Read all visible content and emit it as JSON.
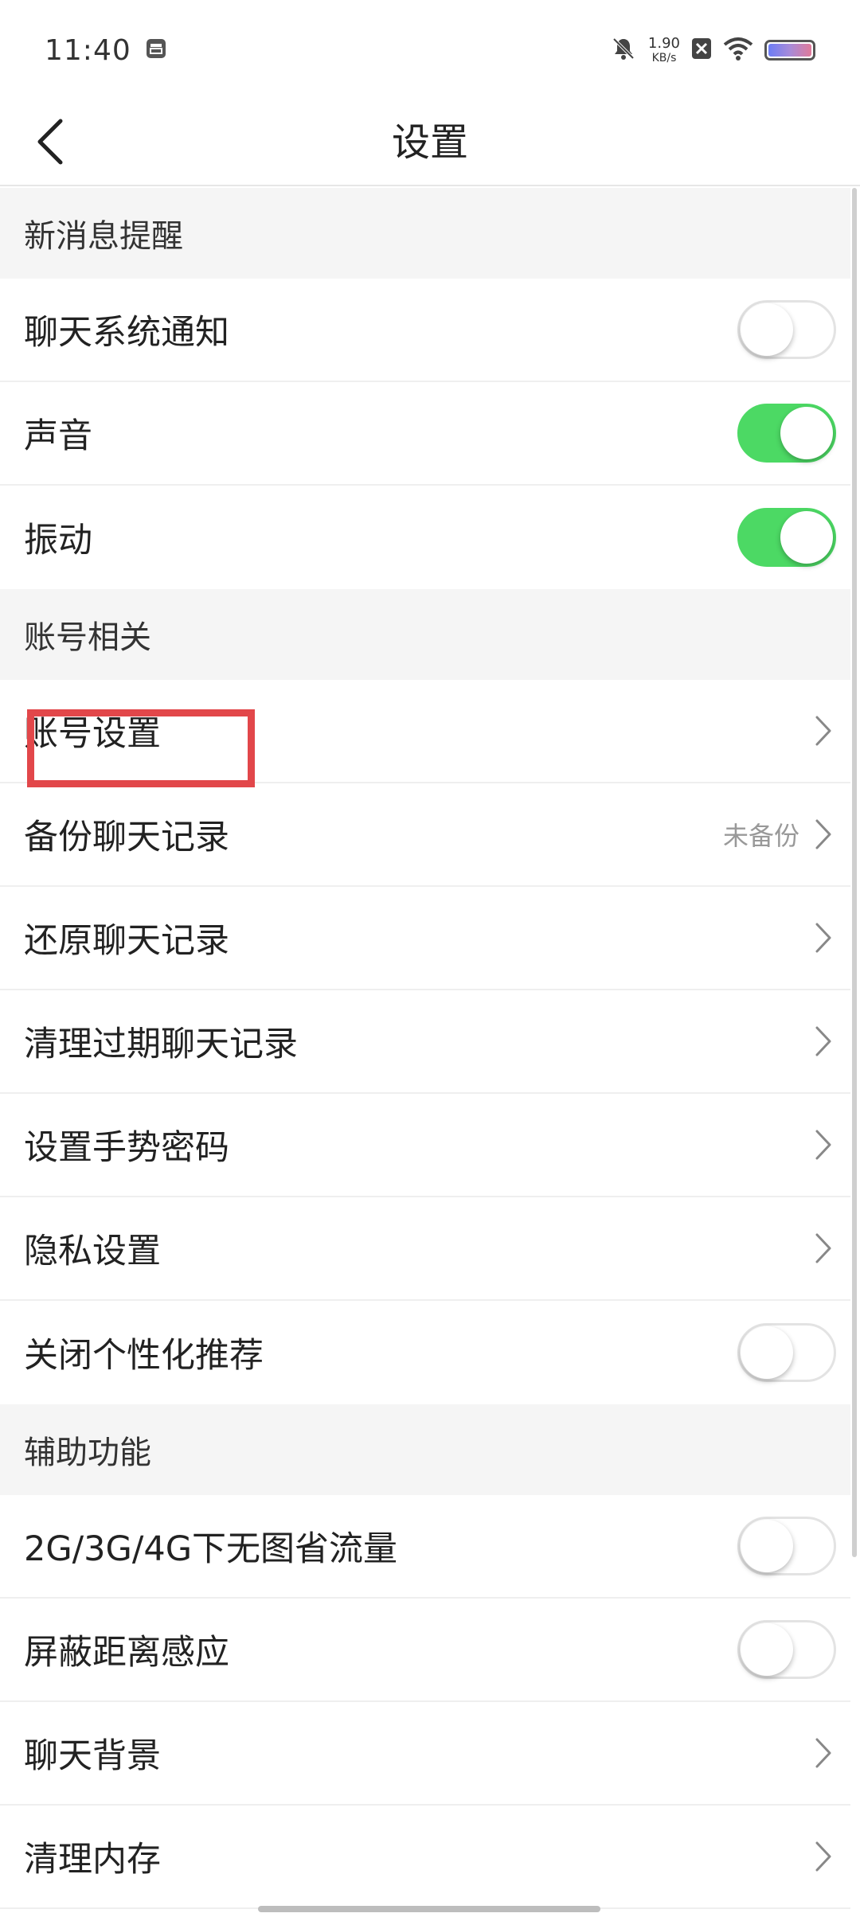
{
  "status_bar": {
    "time": "11:40",
    "net_speed_value": "1.90",
    "net_speed_unit": "KB/s"
  },
  "nav": {
    "title": "设置"
  },
  "sections": {
    "notifications": {
      "header": "新消息提醒",
      "chat_system_notice": {
        "label": "聊天系统通知",
        "enabled": false
      },
      "sound": {
        "label": "声音",
        "enabled": true
      },
      "vibration": {
        "label": "振动",
        "enabled": true
      }
    },
    "account": {
      "header": "账号相关",
      "account_settings": {
        "label": "账号设置"
      },
      "backup_chats": {
        "label": "备份聊天记录",
        "hint": "未备份"
      },
      "restore_chats": {
        "label": "还原聊天记录"
      },
      "clean_expired": {
        "label": "清理过期聊天记录"
      },
      "gesture_password": {
        "label": "设置手势密码"
      },
      "privacy": {
        "label": "隐私设置"
      },
      "disable_recommend": {
        "label": "关闭个性化推荐",
        "enabled": false
      }
    },
    "assist": {
      "header": "辅助功能",
      "no_images_mobile": {
        "label": "2G/3G/4G下无图省流量",
        "enabled": false
      },
      "proximity_sensor": {
        "label": "屏蔽距离感应",
        "enabled": false
      },
      "chat_background": {
        "label": "聊天背景"
      },
      "clear_cache": {
        "label": "清理内存"
      }
    }
  },
  "colors": {
    "toggle_on": "#4cd964",
    "highlight": "#e2474a",
    "section_bg": "#f5f5f5"
  }
}
